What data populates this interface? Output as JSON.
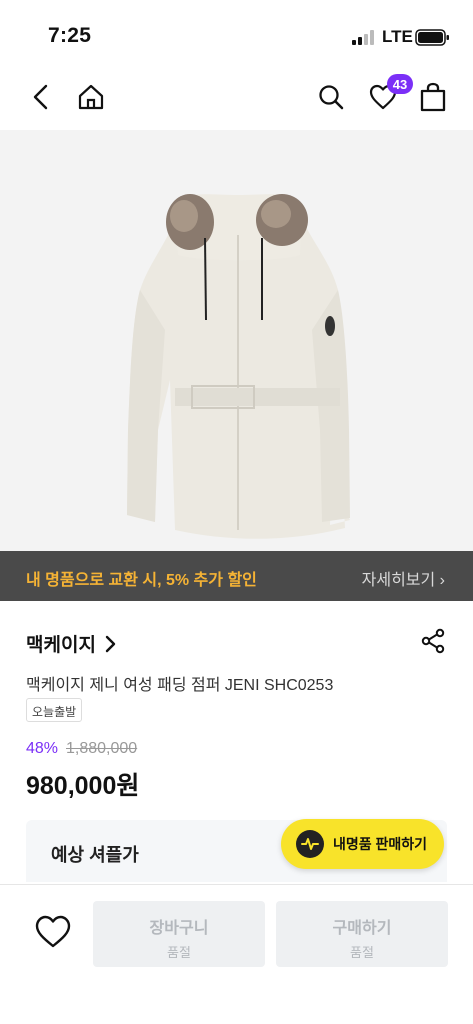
{
  "status_bar": {
    "time": "7:25",
    "network": "LTE"
  },
  "nav": {
    "wishlist_count": "43"
  },
  "promo": {
    "text": "내 명품으로 교환 시, 5% 추가 할인",
    "more": "자세히보기 ›"
  },
  "product": {
    "brand": "맥케이지",
    "name": "맥케이지 제니 여성 패딩 점퍼 JENI SHC0253",
    "tag": "오늘출발",
    "discount": "48%",
    "original_price": "1,880,000",
    "price": "980,000원"
  },
  "flea_price": {
    "label": "예상 셔플가"
  },
  "sell_button": {
    "label": "내명품 판매하기"
  },
  "bottom_bar": {
    "cart": {
      "label": "장바구니",
      "status": "품절"
    },
    "buy": {
      "label": "구매하기",
      "status": "품절"
    }
  },
  "colors": {
    "accent_purple": "#7b2ff7",
    "promo_orange": "#f5b335",
    "fab_yellow": "#f8e32a"
  }
}
